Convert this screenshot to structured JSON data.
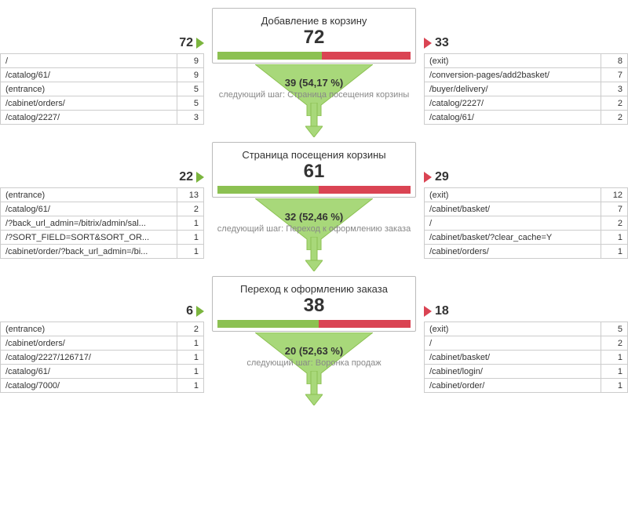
{
  "next_label_prefix": "следующий шаг: ",
  "steps": [
    {
      "title": "Добавление в корзину",
      "count": "72",
      "in_count": "72",
      "out_count": "33",
      "green_pct": 54.17,
      "next_count": "39 (54,17 %)",
      "next_step_name": "Страница посещения корзины",
      "left_rows": [
        {
          "path": "/",
          "n": "9"
        },
        {
          "path": "/catalog/61/",
          "n": "9"
        },
        {
          "path": "(entrance)",
          "n": "5"
        },
        {
          "path": "/cabinet/orders/",
          "n": "5"
        },
        {
          "path": "/catalog/2227/",
          "n": "3"
        }
      ],
      "right_rows": [
        {
          "path": "(exit)",
          "n": "8"
        },
        {
          "path": "/conversion-pages/add2basket/",
          "n": "7"
        },
        {
          "path": "/buyer/delivery/",
          "n": "3"
        },
        {
          "path": "/catalog/2227/",
          "n": "2"
        },
        {
          "path": "/catalog/61/",
          "n": "2"
        }
      ]
    },
    {
      "title": "Страница посещения корзины",
      "count": "61",
      "in_count": "22",
      "out_count": "29",
      "green_pct": 52.46,
      "next_count": "32 (52,46 %)",
      "next_step_name": "Переход к оформлению заказа",
      "left_rows": [
        {
          "path": "(entrance)",
          "n": "13"
        },
        {
          "path": "/catalog/61/",
          "n": "2"
        },
        {
          "path": "/?back_url_admin=/bitrix/admin/sal...",
          "n": "1"
        },
        {
          "path": "/?SORT_FIELD=SORT&SORT_OR...",
          "n": "1"
        },
        {
          "path": "/cabinet/order/?back_url_admin=/bi...",
          "n": "1"
        }
      ],
      "right_rows": [
        {
          "path": "(exit)",
          "n": "12"
        },
        {
          "path": "/cabinet/basket/",
          "n": "7"
        },
        {
          "path": "/",
          "n": "2"
        },
        {
          "path": "/cabinet/basket/?clear_cache=Y",
          "n": "1"
        },
        {
          "path": "/cabinet/orders/",
          "n": "1"
        }
      ]
    },
    {
      "title": "Переход к оформлению заказа",
      "count": "38",
      "in_count": "6",
      "out_count": "18",
      "green_pct": 52.63,
      "next_count": "20 (52,63 %)",
      "next_step_name": "Воронка продаж",
      "left_rows": [
        {
          "path": "(entrance)",
          "n": "2"
        },
        {
          "path": "/cabinet/orders/",
          "n": "1"
        },
        {
          "path": "/catalog/2227/126717/",
          "n": "1"
        },
        {
          "path": "/catalog/61/",
          "n": "1"
        },
        {
          "path": "/catalog/7000/",
          "n": "1"
        }
      ],
      "right_rows": [
        {
          "path": "(exit)",
          "n": "5"
        },
        {
          "path": "/",
          "n": "2"
        },
        {
          "path": "/cabinet/basket/",
          "n": "1"
        },
        {
          "path": "/cabinet/login/",
          "n": "1"
        },
        {
          "path": "/cabinet/order/",
          "n": "1"
        }
      ]
    }
  ]
}
